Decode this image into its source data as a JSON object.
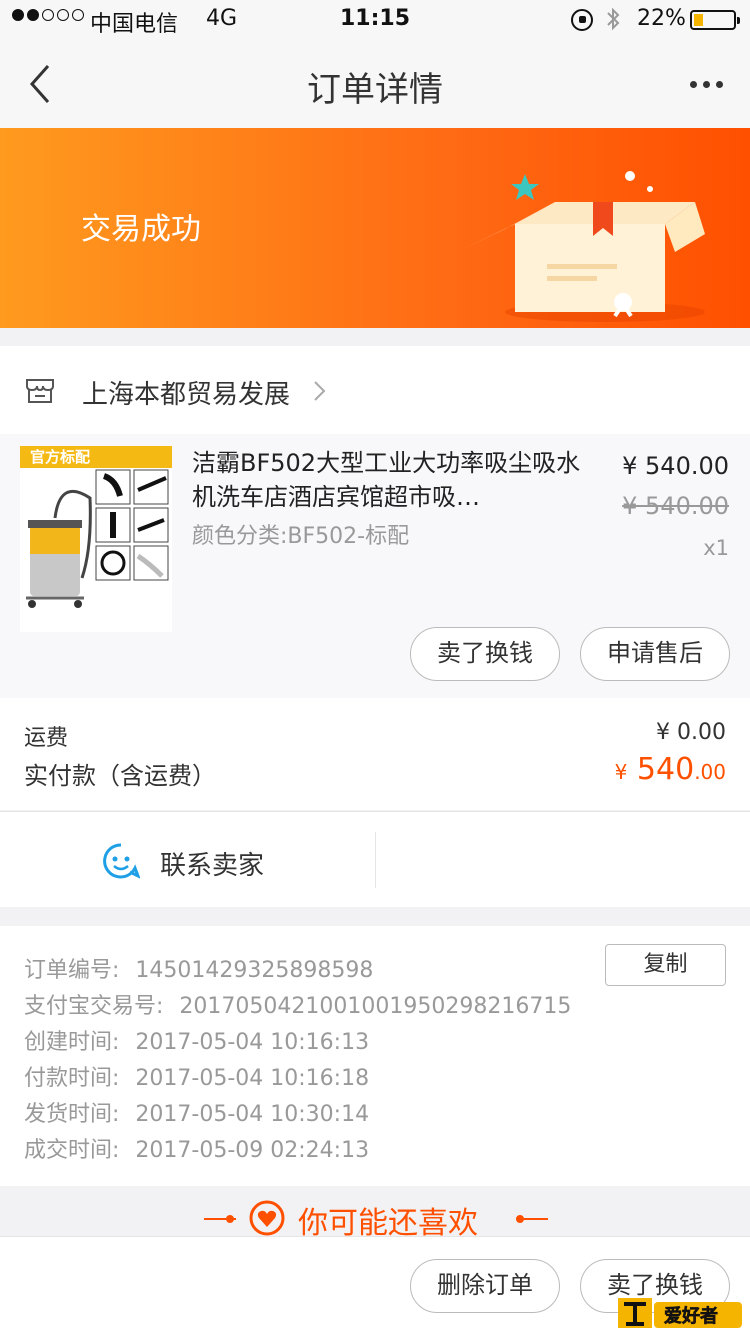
{
  "status_bar": {
    "carrier": "中国电信",
    "network": "4G",
    "time": "11:15",
    "battery_pct": "22%",
    "signal_bars_filled": 2,
    "signal_bars_total": 5
  },
  "nav": {
    "title": "订单详情"
  },
  "banner": {
    "status_text": "交易成功",
    "colors": {
      "start": "#ff9a1e",
      "end": "#ff5000"
    }
  },
  "shop": {
    "name": "上海本都贸易发展"
  },
  "item": {
    "tag": "官方标配",
    "title": "洁霸BF502大型工业大功率吸尘吸水机洗车店酒店宾馆超市吸…",
    "sku": "颜色分类:BF502-标配",
    "price": "¥ 540.00",
    "original_price": "¥ 540.00",
    "quantity": "x1",
    "buttons": {
      "sell": "卖了换钱",
      "after_sale": "申请售后"
    }
  },
  "payment": {
    "shipping_label": "运费",
    "shipping_value": "¥ 0.00",
    "total_label": "实付款（含运费）",
    "total_currency": "¥",
    "total_int": " 540",
    "total_dec": ".00",
    "accent": "#ff5000"
  },
  "contact": {
    "label": "联系卖家"
  },
  "order_info": {
    "copy_label": "复制",
    "rows": [
      {
        "label": "订单编号:",
        "value": "14501429325898598"
      },
      {
        "label": "支付宝交易号:",
        "value": "2017050421001001950298216715"
      },
      {
        "label": "创建时间:",
        "value": "2017-05-04 10:16:13"
      },
      {
        "label": "付款时间:",
        "value": "2017-05-04 10:16:18"
      },
      {
        "label": "发货时间:",
        "value": "2017-05-04 10:30:14"
      },
      {
        "label": "成交时间:",
        "value": "2017-05-09 02:24:13"
      }
    ]
  },
  "recommend": {
    "title": "你可能还喜欢"
  },
  "bottom_bar": {
    "delete": "删除订单",
    "sell": "卖了换钱"
  },
  "watermark": {
    "text": "爱好者"
  }
}
